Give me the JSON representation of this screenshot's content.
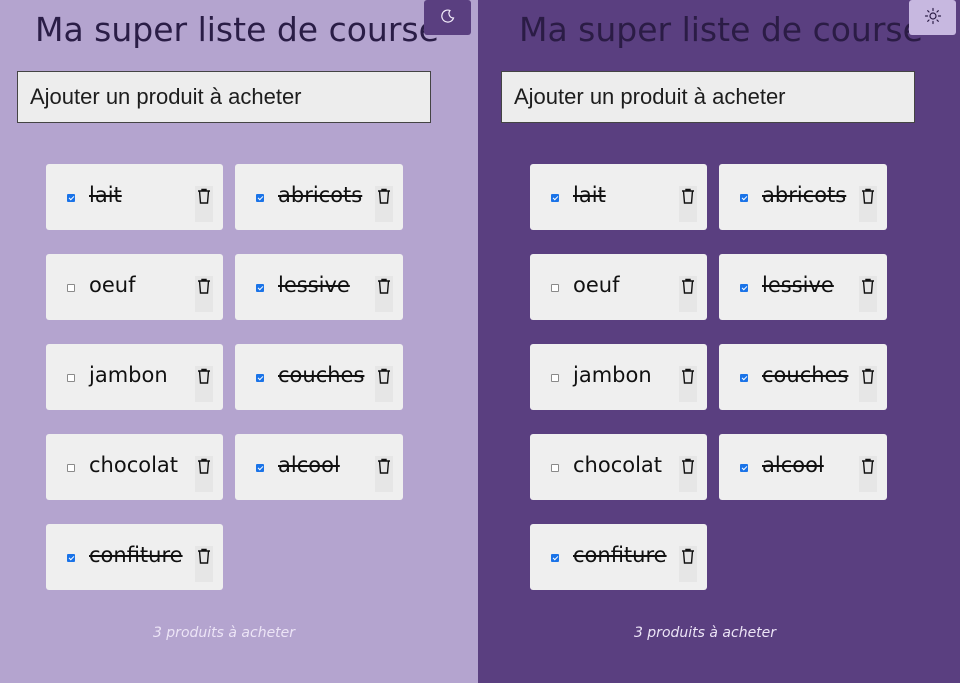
{
  "title": "Ma super liste de course",
  "input_placeholder": "Ajouter un produit à acheter",
  "footer": "3 produits à acheter",
  "icons": {
    "light_toggle": "moon-icon",
    "dark_toggle": "sun-icon",
    "delete": "trash-icon"
  },
  "colors": {
    "light_bg": "#b4a4cf",
    "dark_bg": "#5a3f80",
    "checkbox_accent": "#1a73e8"
  },
  "items": [
    {
      "label": "lait",
      "checked": true
    },
    {
      "label": "abricots",
      "checked": true
    },
    {
      "label": "oeuf",
      "checked": false
    },
    {
      "label": "lessive",
      "checked": true
    },
    {
      "label": "jambon",
      "checked": false
    },
    {
      "label": "couches",
      "checked": true
    },
    {
      "label": "chocolat",
      "checked": false
    },
    {
      "label": "alcool",
      "checked": true
    },
    {
      "label": "confiture",
      "checked": true
    }
  ]
}
